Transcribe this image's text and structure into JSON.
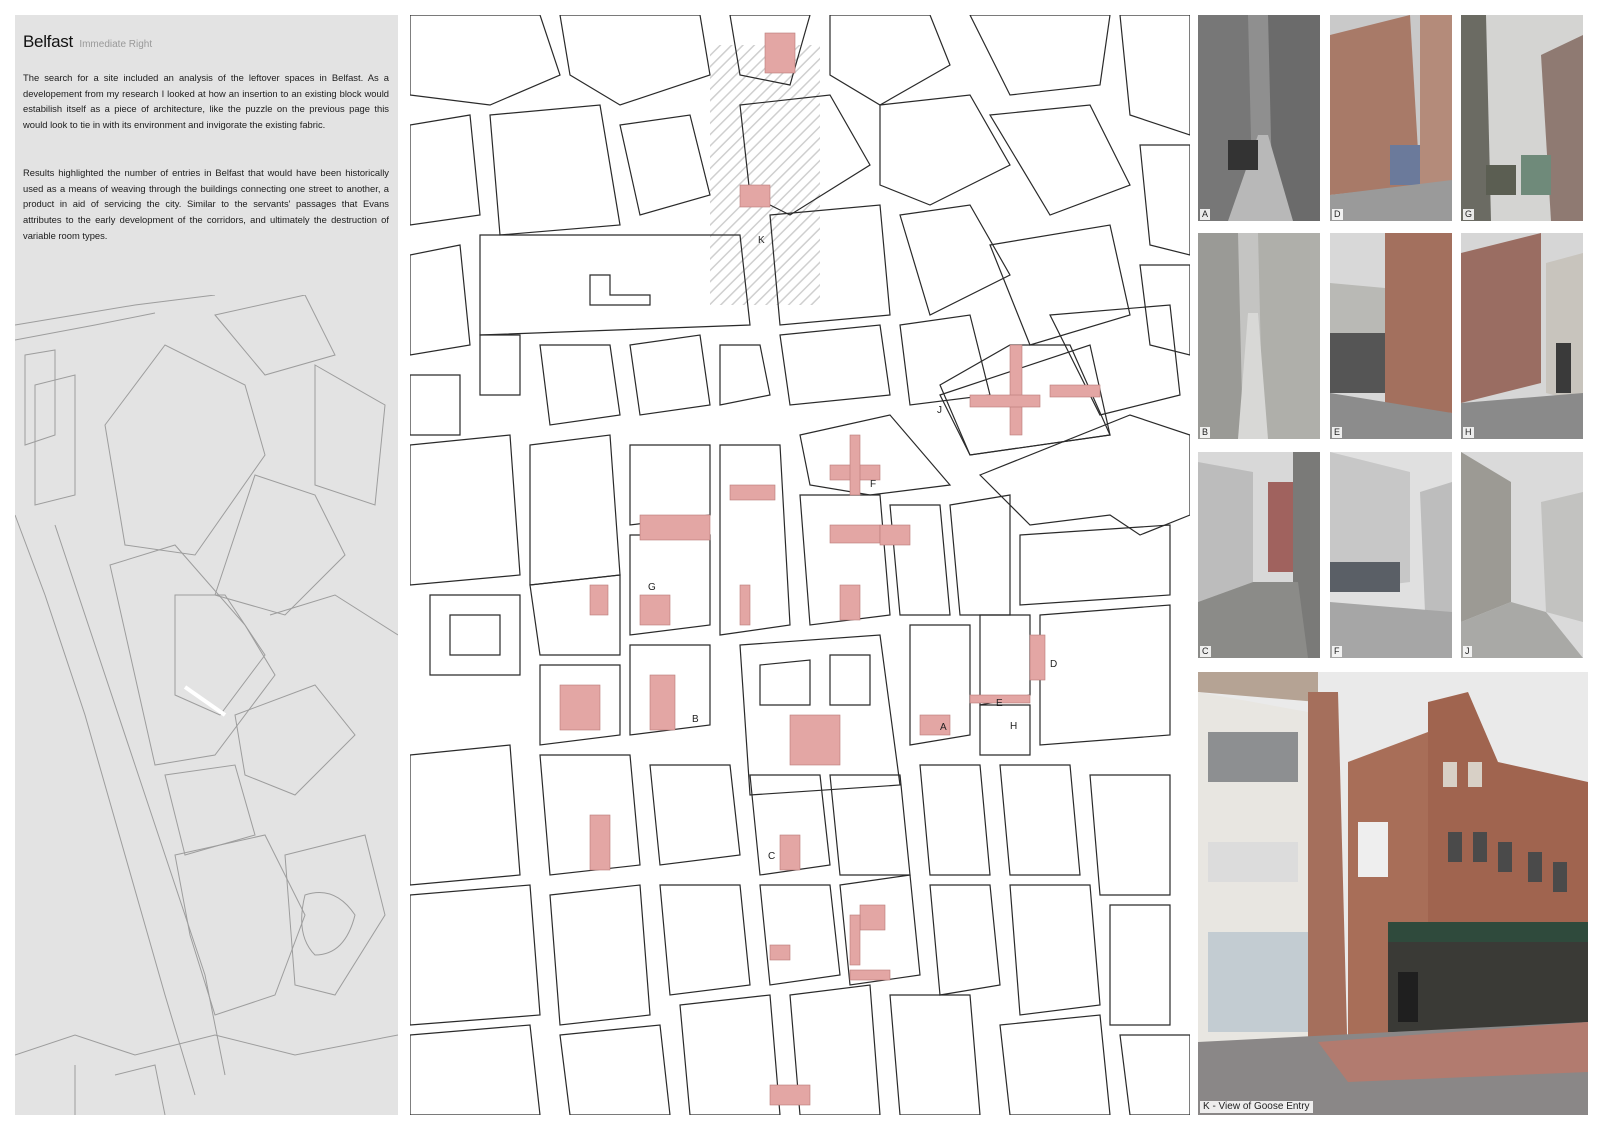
{
  "panel": {
    "title": "Belfast",
    "subtitle": "Immediate Right",
    "paragraph_1": "The search for a site included an analysis of the leftover spaces in Belfast. As a developement from my research I looked at how an insertion to an existing block would estabilish itself as a piece of architecture, like the puzzle on the previous page this would look to tie in with its environment and invigorate the existing fabric.",
    "paragraph_2": "Results highlighted the number of entries in Belfast that would have been historically used as a means of weaving through the buildings connecting one street to another, a product in aid of servicing the city. Similar to the servants' passages that Evans attributes to the early development of the corridors, and ultimately the destruction of variable room types."
  },
  "map": {
    "markers": [
      "K",
      "J",
      "F",
      "G",
      "D",
      "E",
      "H",
      "A",
      "B",
      "C"
    ],
    "highlight_color": "#e3a6a4",
    "line_color": "#2a2a2a"
  },
  "photos": [
    {
      "label": "A",
      "tone": "#9a9a9a"
    },
    {
      "label": "D",
      "tone": "#a8867a"
    },
    {
      "label": "G",
      "tone": "#8f8f86"
    },
    {
      "label": "B",
      "tone": "#b3b3b0"
    },
    {
      "label": "E",
      "tone": "#a9806f"
    },
    {
      "label": "H",
      "tone": "#9d7f78"
    },
    {
      "label": "C",
      "tone": "#a8968f"
    },
    {
      "label": "F",
      "tone": "#b9b9b9"
    },
    {
      "label": "J",
      "tone": "#b0afaa"
    }
  ],
  "big_photo": {
    "label": "K - View of Goose Entry"
  }
}
